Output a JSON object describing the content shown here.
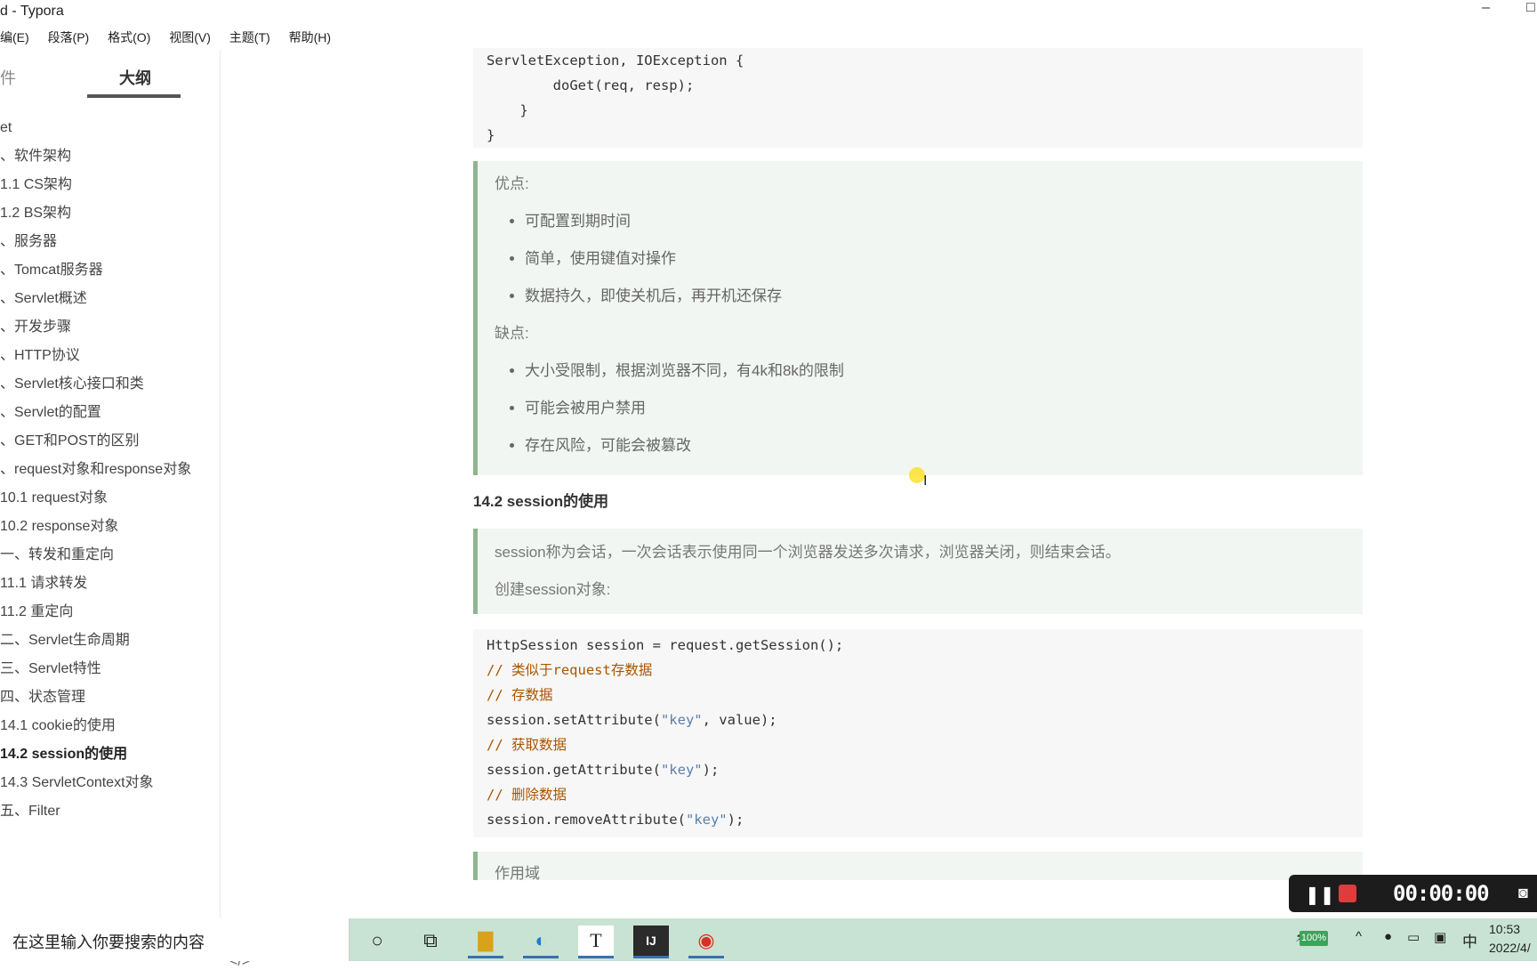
{
  "window": {
    "title": "d - Typora",
    "minimize": "–",
    "maximize": "□"
  },
  "menu": [
    "编(E)",
    "段落(P)",
    "格式(O)",
    "视图(V)",
    "主题(T)",
    "帮助(H)"
  ],
  "sidebar": {
    "tab_files": "件",
    "tab_outline": "大纲",
    "outline": [
      "et",
      "、软件架构",
      "1.1 CS架构",
      "1.2 BS架构",
      "、服务器",
      "、Tomcat服务器",
      "、Servlet概述",
      "、开发步骤",
      "、HTTP协议",
      "、Servlet核心接口和类",
      "、Servlet的配置",
      "、GET和POST的区别",
      "、request对象和response对象",
      "10.1 request对象",
      "10.2 response对象",
      "一、转发和重定向",
      "11.1 请求转发",
      "11.2 重定向",
      "二、Servlet生命周期",
      "三、Servlet特性",
      "四、状态管理",
      "14.1 cookie的使用",
      "14.2 session的使用",
      "14.3 ServletContext对象",
      "五、Filter"
    ],
    "active_index": 22,
    "foot_back": "<",
    "foot_source": "</>"
  },
  "doc": {
    "code1": [
      "ServletException, IOException {",
      "        doGet(req, resp);",
      "    }",
      "}"
    ],
    "pros_title": "优点:",
    "pros": [
      "可配置到期时间",
      "简单，使用键值对操作",
      "数据持久，即使关机后，再开机还保存"
    ],
    "cons_title": "缺点:",
    "cons": [
      "大小受限制，根据浏览器不同，有4k和8k的限制",
      "可能会被用户禁用",
      "存在风险，可能会被篡改"
    ],
    "heading": "14.2 session的使用",
    "session_desc": "session称为会话，一次会话表示使用同一个浏览器发送多次请求，浏览器关闭，则结束会话。",
    "session_create": "创建session对象:",
    "code2": [
      {
        "t": "plain",
        "s": "HttpSession session = request.getSession();"
      },
      {
        "t": "comment",
        "s": "// 类似于request存数据"
      },
      {
        "t": "comment",
        "s": "// 存数据"
      },
      {
        "t": "mixed",
        "a": "session.setAttribute(",
        "b": "\"key\"",
        "c": ", value);"
      },
      {
        "t": "comment",
        "s": "// 获取数据"
      },
      {
        "t": "mixed",
        "a": "session.getAttribute(",
        "b": "\"key\"",
        "c": ");"
      },
      {
        "t": "comment",
        "s": "// 删除数据"
      },
      {
        "t": "mixed",
        "a": "session.removeAttribute(",
        "b": "\"key\"",
        "c": ");"
      }
    ],
    "next_quote_partial": "作用域"
  },
  "recorder": {
    "time": "00:00:00"
  },
  "taskbar": {
    "search_placeholder": "在这里输入你要搜索的内容",
    "battery": "100%",
    "ime": "中",
    "time": "10:53",
    "date": "2022/4/"
  }
}
